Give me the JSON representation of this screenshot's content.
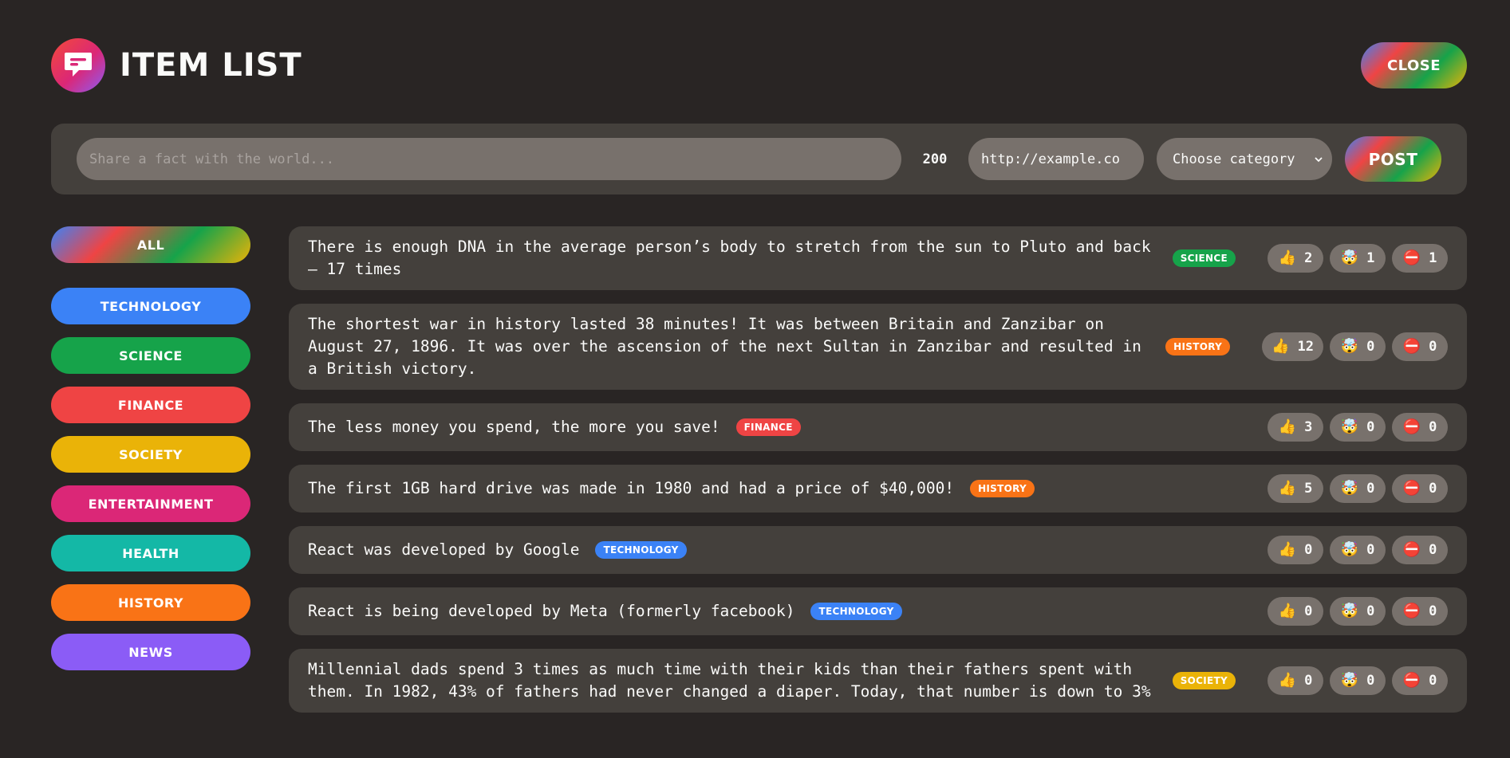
{
  "header": {
    "title": "Item List",
    "close_label": "Close",
    "logo_icon": "chat-bubble-icon"
  },
  "form": {
    "fact_placeholder": "Share a fact with the world...",
    "fact_value": "",
    "char_count": "200",
    "url_value": "http://example.co",
    "category_selected": "Choose category",
    "post_label": "Post"
  },
  "sidebar": {
    "all_label": "All",
    "categories": [
      {
        "label": "Technology",
        "color": "#3b82f6"
      },
      {
        "label": "Science",
        "color": "#16a34a"
      },
      {
        "label": "Finance",
        "color": "#ef4444"
      },
      {
        "label": "Society",
        "color": "#eab308"
      },
      {
        "label": "Entertainment",
        "color": "#db2777"
      },
      {
        "label": "Health",
        "color": "#14b8a6"
      },
      {
        "label": "History",
        "color": "#f97316"
      },
      {
        "label": "News",
        "color": "#8b5cf6"
      }
    ]
  },
  "facts": [
    {
      "text": "There is enough DNA in the average person’s body to stretch from the sun to Pluto and back — 17 times",
      "category": "science",
      "color": "#16a34a",
      "interesting": "2",
      "mindblowing": "1",
      "false": "1"
    },
    {
      "text": "The shortest war in history lasted 38 minutes! It was between Britain and Zanzibar on August 27, 1896. It was over the ascension of the next Sultan in Zanzibar and resulted in a British victory.",
      "category": "history",
      "color": "#f97316",
      "interesting": "12",
      "mindblowing": "0",
      "false": "0"
    },
    {
      "text": "The less money you spend, the more you save!",
      "category": "finance",
      "color": "#ef4444",
      "interesting": "3",
      "mindblowing": "0",
      "false": "0"
    },
    {
      "text": "The first 1GB hard drive was made in 1980 and had a price of $40,000!",
      "category": "history",
      "color": "#f97316",
      "interesting": "5",
      "mindblowing": "0",
      "false": "0"
    },
    {
      "text": "React was developed by Google",
      "category": "technology",
      "color": "#3b82f6",
      "interesting": "0",
      "mindblowing": "0",
      "false": "0"
    },
    {
      "text": "React is being developed by Meta (formerly facebook)",
      "category": "technology",
      "color": "#3b82f6",
      "interesting": "0",
      "mindblowing": "0",
      "false": "0"
    },
    {
      "text": "Millennial dads spend 3 times as much time with their kids than their fathers spent with them. In 1982, 43% of fathers had never changed a diaper. Today, that number is down to 3%",
      "category": "society",
      "color": "#eab308",
      "interesting": "0",
      "mindblowing": "0",
      "false": "0"
    }
  ],
  "vote_icons": {
    "interesting": "thumbs-up-icon",
    "mindblowing": "mind-blown-icon",
    "false": "no-entry-icon"
  }
}
